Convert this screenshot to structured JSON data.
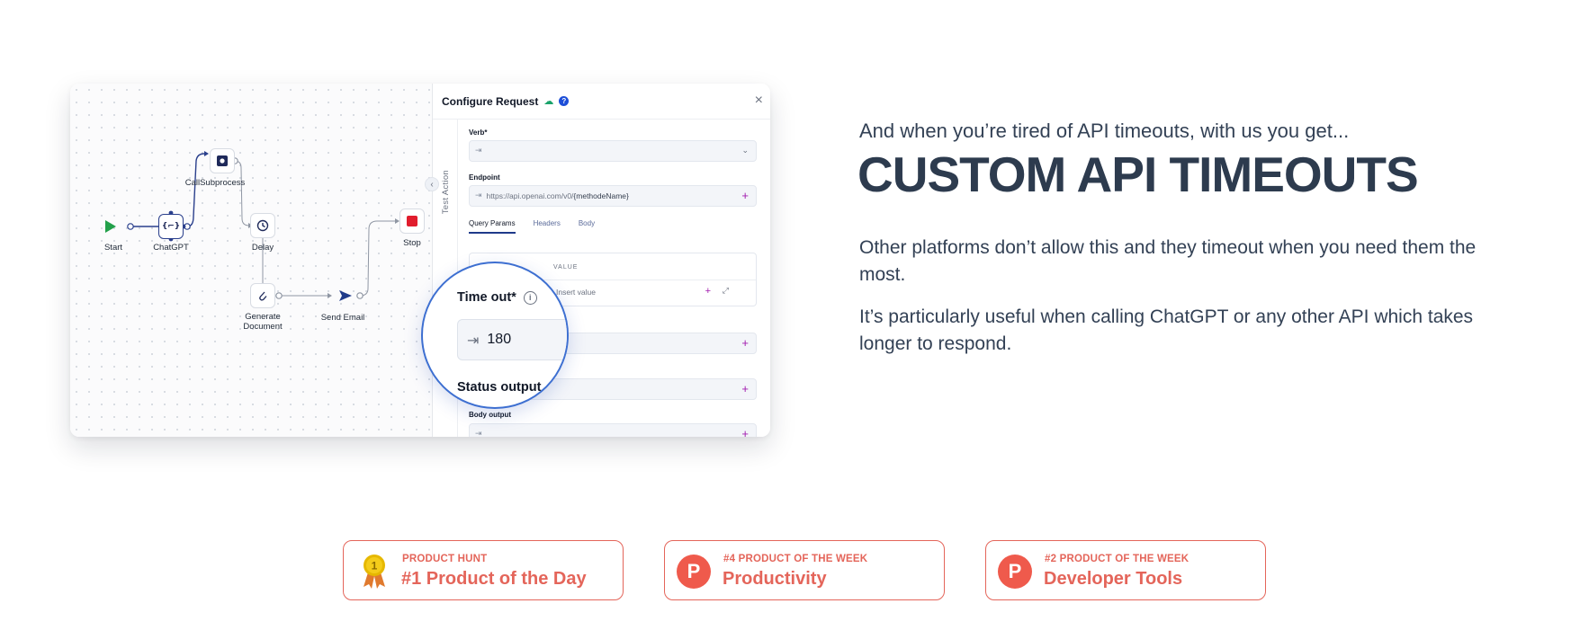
{
  "workflow": {
    "nodes": {
      "start": "Start",
      "chatgpt": "ChatGPT",
      "chatgpt_glyph": "{⌐}",
      "callsubprocess": "CallSubprocess",
      "delay": "Delay",
      "generate_document_line1": "Generate",
      "generate_document_line2": "Document",
      "send_email": "Send Email",
      "stop": "Stop"
    }
  },
  "config_panel": {
    "title": "Configure Request",
    "rail_label": "Test Action",
    "verb_label": "Verb*",
    "endpoint_label": "Endpoint",
    "endpoint_prefix": "https://api.openai.com/v0/",
    "endpoint_variable": "{methodeName}",
    "tabs": [
      "Query Params",
      "Headers",
      "Body"
    ],
    "table_header_value": "VALUE",
    "insert_value_placeholder": "Insert value",
    "body_output_label": "Body output"
  },
  "magnifier": {
    "timeout_label": "Time out*",
    "timeout_value": "180",
    "status_output_label": "Status output"
  },
  "hero": {
    "intro": "And when you’re tired of API timeouts, with us you get...",
    "headline": "CUSTOM API TIMEOUTS",
    "paragraph1": "Other platforms don’t allow this and they timeout when you need them the most.",
    "paragraph2": "It’s particularly useful when calling ChatGPT or any other API which takes longer to respond."
  },
  "badges": [
    {
      "kicker": "PRODUCT HUNT",
      "title": "#1 Product of the Day",
      "icon": "gold-medal-icon",
      "medal_number": "1"
    },
    {
      "kicker": "#4 PRODUCT OF THE WEEK",
      "title": "Productivity",
      "icon": "product-hunt-logo",
      "logo_letter": "P"
    },
    {
      "kicker": "#2 PRODUCT OF THE WEEK",
      "title": "Developer Tools",
      "icon": "product-hunt-logo",
      "logo_letter": "P"
    }
  ],
  "colors": {
    "accent_navy": "#2d3b4e",
    "badge_red": "#e4655a",
    "magnifier_blue": "#3d6fd1",
    "plus_magenta": "#a21caf",
    "stop_red": "#e11d2d",
    "start_green": "#22a04a"
  }
}
